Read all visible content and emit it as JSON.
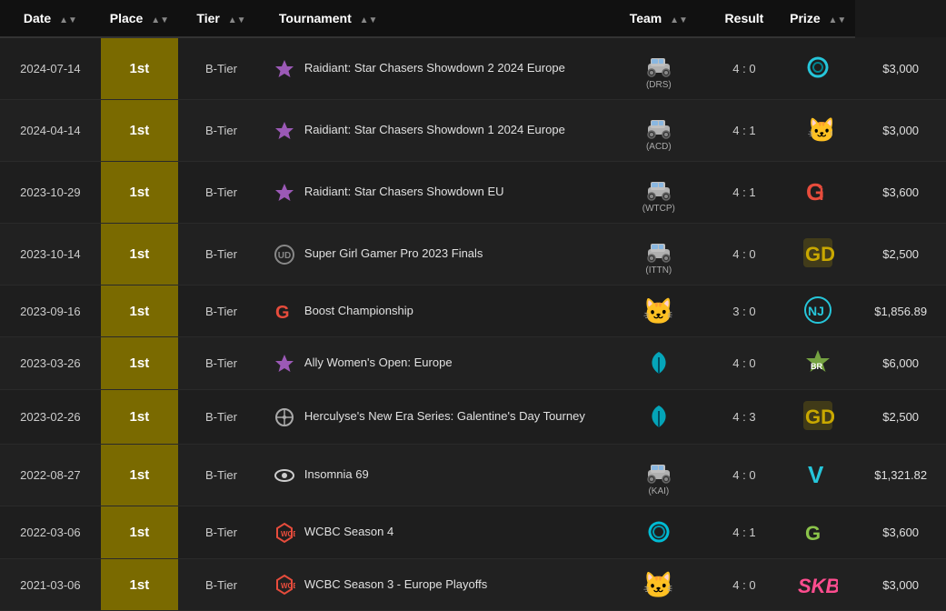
{
  "table": {
    "headers": [
      {
        "label": "Date",
        "key": "date"
      },
      {
        "label": "Place",
        "key": "place"
      },
      {
        "label": "Tier",
        "key": "tier"
      },
      {
        "label": "Tournament",
        "key": "tournament"
      },
      {
        "label": "Team",
        "key": "team"
      },
      {
        "label": "Result",
        "key": "result"
      },
      {
        "label": "Prize",
        "key": "prize"
      }
    ],
    "rows": [
      {
        "date": "2024-07-14",
        "place": "1st",
        "tier": "B-Tier",
        "tournament_icon": "raidiant",
        "tournament": "Raidiant: Star Chasers Showdown 2 2024 Europe",
        "team_abbr": "DRS",
        "team_icon": "rl-car",
        "result": "4 : 0",
        "opponent_icon": "spiral",
        "prize": "$3,000"
      },
      {
        "date": "2024-04-14",
        "place": "1st",
        "tier": "B-Tier",
        "tournament_icon": "raidiant",
        "tournament": "Raidiant: Star Chasers Showdown 1 2024 Europe",
        "team_abbr": "ACD",
        "team_icon": "rl-car",
        "result": "4 : 1",
        "opponent_icon": "cat",
        "prize": "$3,000"
      },
      {
        "date": "2023-10-29",
        "place": "1st",
        "tier": "B-Tier",
        "tournament_icon": "raidiant",
        "tournament": "Raidiant: Star Chasers Showdown EU",
        "team_abbr": "WTCP",
        "team_icon": "rl-car",
        "result": "4 : 1",
        "opponent_icon": "G-red",
        "prize": "$3,600"
      },
      {
        "date": "2023-10-14",
        "place": "1st",
        "tier": "B-Tier",
        "tournament_icon": "sgp",
        "tournament": "Super Girl Gamer Pro 2023 Finals",
        "team_abbr": "ITTN",
        "team_icon": "rl-car",
        "result": "4 : 0",
        "opponent_icon": "GD",
        "prize": "$2,500"
      },
      {
        "date": "2023-09-16",
        "place": "1st",
        "tier": "B-Tier",
        "tournament_icon": "boost",
        "tournament": "Boost Championship",
        "team_abbr": "",
        "team_icon": "cat-dark",
        "result": "3 : 0",
        "opponent_icon": "NJ",
        "prize": "$1,856.89"
      },
      {
        "date": "2023-03-26",
        "place": "1st",
        "tier": "B-Tier",
        "tournament_icon": "ally",
        "tournament": "Ally Women's Open: Europe",
        "team_abbr": "",
        "team_icon": "leaf-blue",
        "result": "4 : 0",
        "opponent_icon": "star-green",
        "prize": "$6,000"
      },
      {
        "date": "2023-02-26",
        "place": "1st",
        "tier": "B-Tier",
        "tournament_icon": "herc",
        "tournament": "Herculyse's New Era Series: Galentine's Day Tourney",
        "team_abbr": "",
        "team_icon": "leaf-blue",
        "result": "4 : 3",
        "opponent_icon": "GD2",
        "prize": "$2,500"
      },
      {
        "date": "2022-08-27",
        "place": "1st",
        "tier": "B-Tier",
        "tournament_icon": "insomnia",
        "tournament": "Insomnia 69",
        "team_abbr": "KAI",
        "team_icon": "rl-car",
        "result": "4 : 0",
        "opponent_icon": "V-teal",
        "prize": "$1,321.82"
      },
      {
        "date": "2022-03-06",
        "place": "1st",
        "tier": "B-Tier",
        "tournament_icon": "wcbc",
        "tournament": "WCBC Season 4",
        "team_abbr": "",
        "team_icon": "spiral-blue",
        "result": "4 : 1",
        "opponent_icon": "Gg",
        "prize": "$3,600"
      },
      {
        "date": "2021-03-06",
        "place": "1st",
        "tier": "B-Tier",
        "tournament_icon": "wcbc",
        "tournament": "WCBC Season 3 - Europe Playoffs",
        "team_abbr": "",
        "team_icon": "cat-dark2",
        "result": "4 : 0",
        "opponent_icon": "SKB",
        "prize": "$3,000"
      }
    ]
  }
}
